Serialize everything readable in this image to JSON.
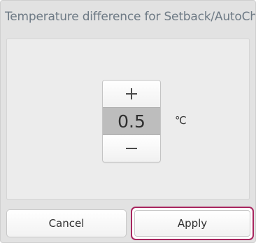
{
  "dialog": {
    "title": "Temperature difference for Setback/AutoChang"
  },
  "stepper": {
    "increment_icon": "plus-icon",
    "decrement_icon": "minus-icon",
    "value": "0.5",
    "unit": "℃"
  },
  "buttons": {
    "cancel_label": "Cancel",
    "apply_label": "Apply"
  },
  "colors": {
    "focus_outline": "#a8265f",
    "title_text": "#6e7a85",
    "value_bg": "#bdbdbd"
  }
}
